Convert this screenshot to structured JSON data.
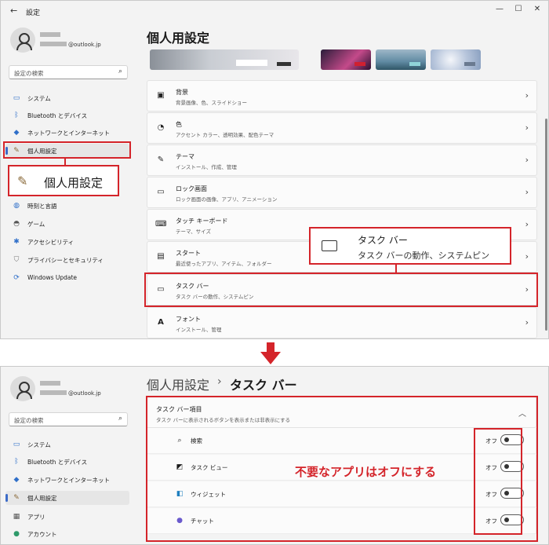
{
  "top_window": {
    "app_title": "設定",
    "back_glyph": "←",
    "controls": {
      "minimize": "—",
      "maximize": "☐",
      "close": "✕"
    },
    "account": {
      "email": "@outlook.jp"
    },
    "search": {
      "placeholder": "設定の検索"
    },
    "nav": [
      {
        "label": "システム",
        "icon": "monitor-icon"
      },
      {
        "label": "Bluetooth とデバイス",
        "icon": "bluetooth-icon"
      },
      {
        "label": "ネットワークとインターネット",
        "icon": "wifi-icon"
      },
      {
        "label": "個人用設定",
        "icon": "brush-icon",
        "selected": true
      },
      {
        "label": "時刻と言語",
        "icon": "globe-icon"
      },
      {
        "label": "ゲーム",
        "icon": "gamepad-icon"
      },
      {
        "label": "アクセシビリティ",
        "icon": "accessibility-icon"
      },
      {
        "label": "プライバシーとセキュリティ",
        "icon": "shield-icon"
      },
      {
        "label": "Windows Update",
        "icon": "update-icon"
      }
    ],
    "page_title": "個人用設定",
    "cards": [
      {
        "title": "背景",
        "subtitle": "背景画像、色、スライドショー",
        "icon": "image-icon"
      },
      {
        "title": "色",
        "subtitle": "アクセント カラー、透明効果、配色テーマ",
        "icon": "palette-icon"
      },
      {
        "title": "テーマ",
        "subtitle": "インストール、作成、管理",
        "icon": "pen-icon"
      },
      {
        "title": "ロック画面",
        "subtitle": "ロック画面の画像、アプリ、アニメーション",
        "icon": "lock-screen-icon"
      },
      {
        "title": "タッチ キーボード",
        "subtitle": "テーマ、サイズ",
        "icon": "keyboard-icon"
      },
      {
        "title": "スタート",
        "subtitle": "最近使ったアプリ、アイテム、フォルダー",
        "icon": "start-icon"
      },
      {
        "title": "タスク バー",
        "subtitle": "タスク バーの動作、システムピン",
        "icon": "taskbar-icon"
      },
      {
        "title": "フォント",
        "subtitle": "インストール、管理",
        "icon": "font-icon"
      }
    ],
    "callout_personalize": {
      "label": "個人用設定"
    },
    "callout_taskbar": {
      "title": "タスク バー",
      "subtitle": "タスク バーの動作、システムピン"
    }
  },
  "bottom_window": {
    "account": {
      "email": "@outlook.jp"
    },
    "search": {
      "placeholder": "設定の検索"
    },
    "nav": [
      {
        "label": "システム",
        "icon": "monitor-icon"
      },
      {
        "label": "Bluetooth とデバイス",
        "icon": "bluetooth-icon"
      },
      {
        "label": "ネットワークとインターネット",
        "icon": "wifi-icon"
      },
      {
        "label": "個人用設定",
        "icon": "brush-icon",
        "selected": true
      },
      {
        "label": "アプリ",
        "icon": "apps-icon"
      },
      {
        "label": "アカウント",
        "icon": "person-icon"
      }
    ],
    "breadcrumb_parent": "個人用設定",
    "breadcrumb_sep": "›",
    "breadcrumb_current": "タスク バー",
    "group": {
      "title": "タスク バー項目",
      "subtitle": "タスク バーに表示されるボタンを表示または非表示にする",
      "items": [
        {
          "label": "検索",
          "state": "オフ",
          "icon": "search-icon",
          "on": false
        },
        {
          "label": "タスク ビュー",
          "state": "オフ",
          "icon": "task-view-icon",
          "on": false
        },
        {
          "label": "ウィジェット",
          "state": "オフ",
          "icon": "widgets-icon",
          "on": false
        },
        {
          "label": "チャット",
          "state": "オフ",
          "icon": "chat-icon",
          "on": false
        }
      ]
    },
    "annotation": "不要なアプリはオフにする"
  },
  "colors": {
    "accent_red": "#d4242a",
    "selection_bar": "#3c6bc8",
    "window_bg": "#f3f3f3"
  }
}
